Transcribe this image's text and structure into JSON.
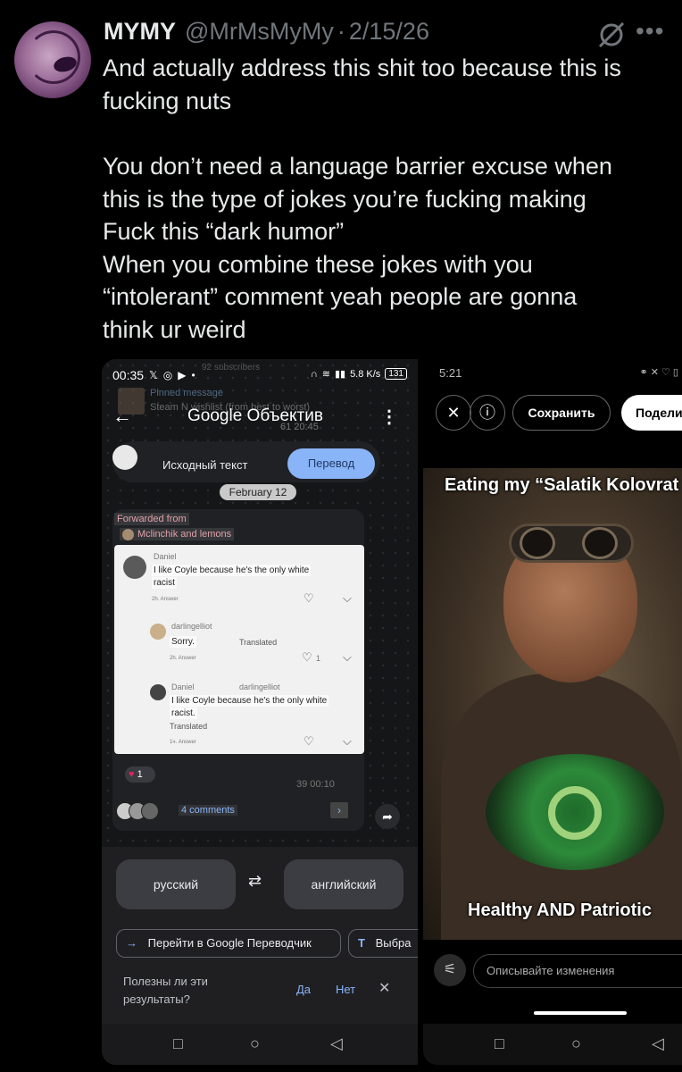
{
  "tweet": {
    "display_name": "MYMY",
    "handle": "@MrMsMyMy",
    "separator": "·",
    "date": "2/15/26",
    "lines": [
      "And actually address this shit too because this is",
      "fucking nuts",
      "",
      "You don’t need a language barrier excuse when",
      "this is the type of jokes you’re fucking making",
      "Fuck this “dark humor”",
      "When you combine these jokes with you",
      "“intolerant” comment yeah people are gonna",
      "think ur weird"
    ],
    "icons": {
      "grok": "grok-icon",
      "more": "more-icon",
      "avatar": "profile-avatar"
    }
  },
  "left_shot": {
    "status_time": "00:35",
    "status_battery": "131",
    "status_speed": "5.8 K/s",
    "subscribers": "92 subscribers",
    "pinned_title": "Pinned message",
    "pinned_text": "Steam N wishlist (from best to worst)",
    "lens_title": "Google Объектив",
    "views_top": "61  20:45",
    "toggle_source": "Исходный текст",
    "toggle_translate": "Перевод",
    "date_pill": "February 12",
    "forwarded_label": "Forwarded from",
    "forwarded_source": "Mclinchik and lemons",
    "comments": [
      {
        "name": "Daniel",
        "text_lines": [
          "I like Coyle because he's the only white",
          "racist"
        ],
        "meta": "2h.   Answer"
      },
      {
        "name": "darlingelliot",
        "text_lines": [
          "Sorry."
        ],
        "badge": "Translated",
        "meta": "2h. Answer",
        "likes": "1"
      },
      {
        "name": "Daniel",
        "reply_to": "darlingelliot",
        "text_lines": [
          "I like Coyle because he's the only white",
          "racist."
        ],
        "badge": "Translated",
        "meta": "1ч.   Answer"
      }
    ],
    "reaction_count": "1",
    "views_bottom": "39  00:10",
    "comments_link": "4 comments",
    "lang_from": "русский",
    "lang_to": "английский",
    "chip_translate": "Перейти в Google Переводчик",
    "chip_select": "Выбра",
    "feedback_line1": "Полезны ли эти",
    "feedback_line2": "результаты?",
    "feedback_yes": "Да",
    "feedback_no": "Нет"
  },
  "right_shot": {
    "status_time": "5:21",
    "save_label": "Сохранить",
    "share_label": "Подели",
    "meme_top": "Eating my “Salatik Kolovrat",
    "meme_bottom": "Healthy AND Patriotic",
    "edit_placeholder": "Описывайте изменения"
  },
  "colors": {
    "background": "#000000",
    "text": "#e7e9ea",
    "muted": "#71767b",
    "accent_blue": "#8ab4f8"
  }
}
